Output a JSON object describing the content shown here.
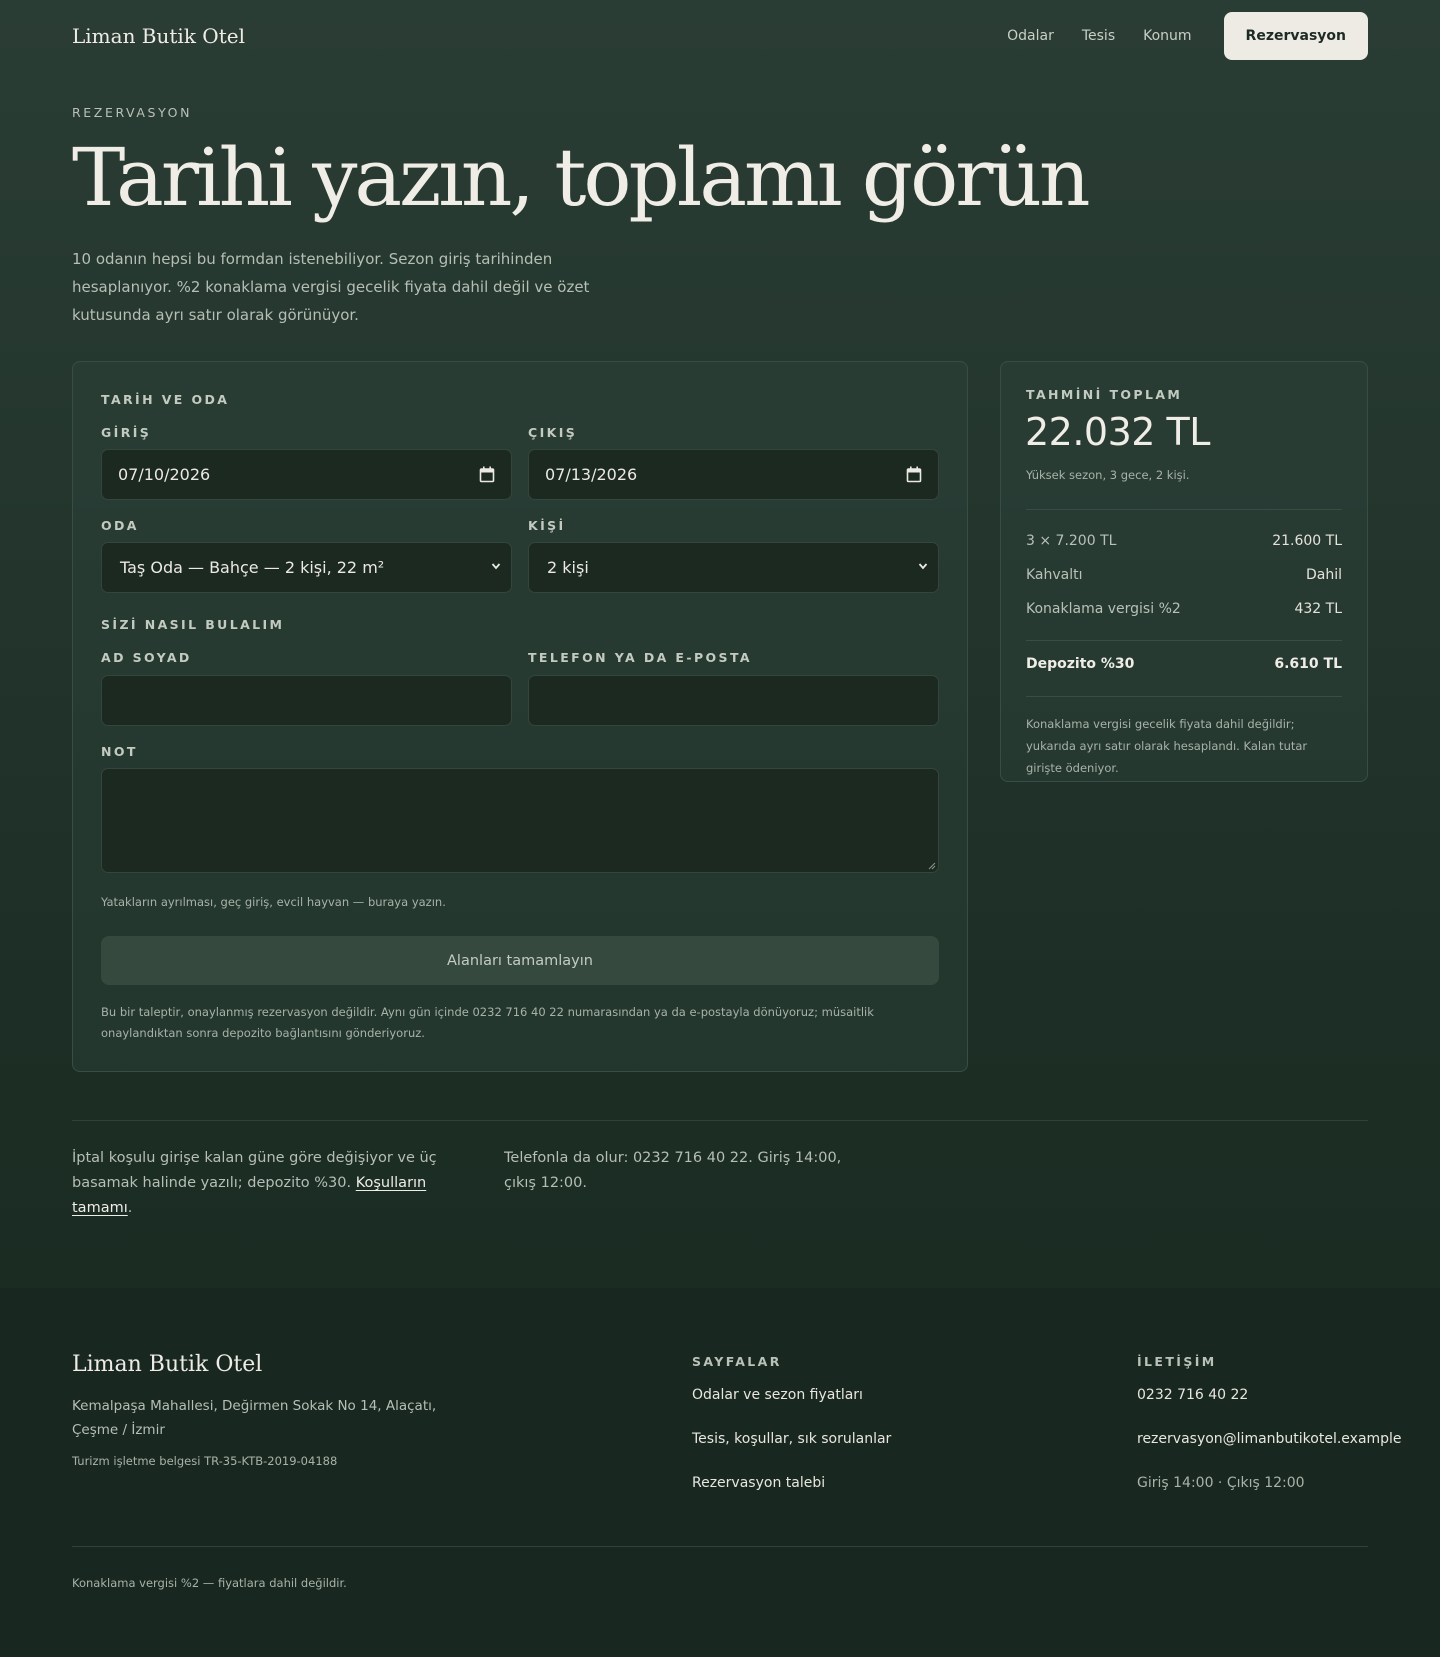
{
  "header": {
    "brand": "Liman Butik Otel",
    "nav": [
      "Odalar",
      "Tesis",
      "Konum"
    ],
    "cta": "Rezervasyon"
  },
  "hero": {
    "eyebrow": "REZERVASYON",
    "title": "Tarihi yazın, toplamı görün",
    "description": "10 odanın hepsi bu formdan istenebiliyor. Sezon giriş tarihinden hesaplanıyor. %2 konaklama vergisi gecelik fiyata dahil değil ve özet kutusunda ayrı satır olarak görünüyor."
  },
  "form": {
    "section_dates": "TARİH VE ODA",
    "checkin_label": "GİRİŞ",
    "checkin_value": "07/10/2026",
    "checkout_label": "ÇIKIŞ",
    "checkout_value": "07/13/2026",
    "room_label": "ODA",
    "room_value": "Taş Oda — Bahçe — 2 kişi, 22 m²",
    "guests_label": "KİŞİ",
    "guests_value": "2 kişi",
    "section_contact": "SİZİ NASIL BULALIM",
    "name_label": "AD SOYAD",
    "name_value": "",
    "contact_label": "TELEFON YA DA E-POSTA",
    "contact_value": "",
    "note_label": "NOT",
    "note_value": "",
    "note_hint": "Yatakların ayrılması, geç giriş, evcil hayvan — buraya yazın.",
    "submit_label": "Alanları tamamlayın",
    "fineprint": "Bu bir taleptir, onaylanmış rezervasyon değildir. Aynı gün içinde 0232 716 40 22 numarasından ya da e-postayla dönüyoruz; müsaitlik onaylandıktan sonra depozito bağlantısını gönderiyoruz."
  },
  "summary": {
    "label": "TAHMİNİ TOPLAM",
    "total": "22.032 TL",
    "subtitle": "Yüksek sezon, 3 gece, 2 kişi.",
    "rows": [
      {
        "label": "3 × 7.200 TL",
        "value": "21.600 TL"
      },
      {
        "label": "Kahvaltı",
        "value": "Dahil"
      },
      {
        "label": "Konaklama vergisi %2",
        "value": "432 TL"
      }
    ],
    "deposit_label": "Depozito %30",
    "deposit_value": "6.610 TL",
    "note": "Konaklama vergisi gecelik fiyata dahil değildir; yukarıda ayrı satır olarak hesaplandı. Kalan tutar girişte ödeniyor."
  },
  "info": {
    "cancel_text": "İptal koşulu girişe kalan güne göre değişiyor ve üç basamak halinde yazılı; depozito %30.",
    "terms_link": "Koşulların tamamı",
    "terms_suffix": ".",
    "phone_text": "Telefonla da olur: 0232 716 40 22. Giriş 14:00, çıkış 12:00."
  },
  "footer": {
    "brand": "Liman Butik Otel",
    "address": "Kemalpaşa Mahallesi, Değirmen Sokak No 14, Alaçatı, Çeşme / İzmir",
    "license": "Turizm işletme belgesi TR-35-KTB-2019-04188",
    "pages_label": "SAYFALAR",
    "pages": [
      "Odalar ve sezon fiyatları",
      "Tesis, koşullar, sık sorulanlar",
      "Rezervasyon talebi"
    ],
    "contact_label": "İLETİŞİM",
    "phone": "0232 716 40 22",
    "email": "rezervasyon@limanbutikotel.example",
    "hours": "Giriş 14:00 · Çıkış 12:00",
    "bottom": "Konaklama vergisi %2 — fiyatlara dahil değildir."
  }
}
